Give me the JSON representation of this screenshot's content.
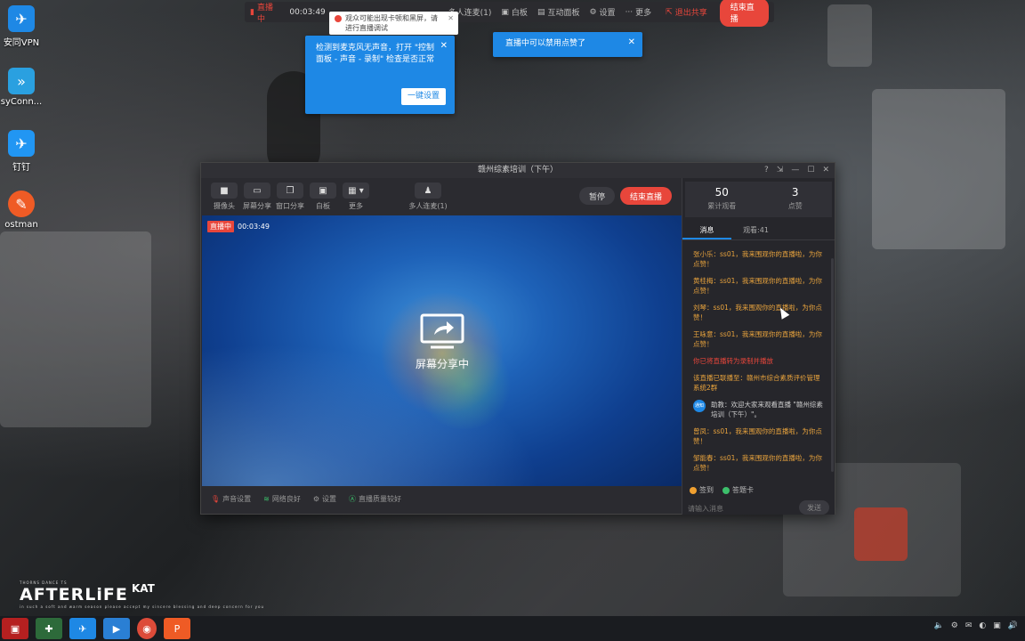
{
  "desktop": {
    "icons": [
      {
        "name": "vpn",
        "label": "安同VPN",
        "color": "#1e88e5",
        "glyph": "✈"
      },
      {
        "name": "easyconnect",
        "label": "syConn...",
        "color": "#2aa0e0",
        "glyph": "»"
      },
      {
        "name": "dingding",
        "label": "钉钉",
        "color": "#2196f3",
        "glyph": "✈"
      },
      {
        "name": "postman",
        "label": "ostman",
        "color": "#ef5b25",
        "glyph": "✎"
      }
    ]
  },
  "topbar": {
    "live_label": "直播中",
    "timer": "00:03:49",
    "items": [
      "多人连麦(1)",
      "白板",
      "互动面板",
      "设置",
      "更多"
    ],
    "share_stop": "退出共享",
    "end_label": "结束直播"
  },
  "warn_toast": {
    "text": "观众可能出现卡顿和黑屏，请进行直播调试"
  },
  "tips": {
    "mic": {
      "text": "检测到麦克风无声音，打开 \"控制面板 - 声音 - 录制\" 检查是否正常",
      "button": "一键设置"
    },
    "like": {
      "text": "直播中可以禁用点赞了"
    }
  },
  "app": {
    "title": "赣州综素培训（下午）",
    "toolbar": [
      {
        "name": "camera",
        "label": "摄像头",
        "glyph": "■"
      },
      {
        "name": "screen-share",
        "label": "屏幕分享",
        "glyph": "▭"
      },
      {
        "name": "window-share",
        "label": "窗口分享",
        "glyph": "❐"
      },
      {
        "name": "whiteboard",
        "label": "白板",
        "glyph": "▣"
      },
      {
        "name": "more",
        "label": "更多",
        "glyph": "▦"
      },
      {
        "name": "multi-mic",
        "label": "多人连麦(1)",
        "glyph": "♟"
      }
    ],
    "pause_label": "暂停",
    "end_label": "结束直播",
    "stage": {
      "rec_tag": "直播中",
      "rec_time": "00:03:49",
      "center_label": "屏幕分享中"
    },
    "status": [
      "声音设置",
      "网络良好",
      "设置",
      "直播质量较好"
    ],
    "stats": {
      "viewers": "50",
      "viewers_label": "累计观看",
      "likes": "3",
      "likes_label": "点赞"
    },
    "tabs": [
      "消息",
      "观看:41"
    ],
    "messages": [
      {
        "type": "normal",
        "text": "张小乐：ss01，我来围观你的直播啦，为你点赞！"
      },
      {
        "type": "normal",
        "text": "黄桂梅：ss01，我来围观你的直播啦，为你点赞！"
      },
      {
        "type": "normal",
        "text": "刘琴：ss01，我来围观你的直播啦，为你点赞！"
      },
      {
        "type": "normal",
        "text": "王咏意：ss01，我来围观你的直播啦，为你点赞！"
      },
      {
        "type": "red",
        "text": "你已将直播转为录制并播放"
      },
      {
        "type": "normal",
        "text": "该直播已联播至：赣州市综合素质评价管理系统2群"
      },
      {
        "type": "sys",
        "avatar": "通知",
        "text": "助教：欢迎大家来观看直播 \"赣州综素培训（下午）\"。"
      },
      {
        "type": "normal",
        "text": "曾凤：ss01，我来围观你的直播啦，为你点赞！"
      },
      {
        "type": "normal",
        "text": "邹能春：ss01，我来围观你的直播啦，为你点赞！"
      }
    ],
    "quick": [
      {
        "label": "签到",
        "color": "#f0a030"
      },
      {
        "label": "答题卡",
        "color": "#3cbf6b"
      }
    ],
    "input_placeholder": "请输入消息",
    "send_label": "发送"
  },
  "logos": {
    "afterlife_top": "THORNS DANCE TS",
    "afterlife": "AFTERLiFE",
    "afterlife_small": "in such a soft and warm season\nplease accept my sincere blessing and deep concern for you",
    "brand2": "KAT"
  },
  "tray": [
    "🔈",
    "⚙",
    "✉",
    "◐",
    "▣",
    "🔊"
  ]
}
